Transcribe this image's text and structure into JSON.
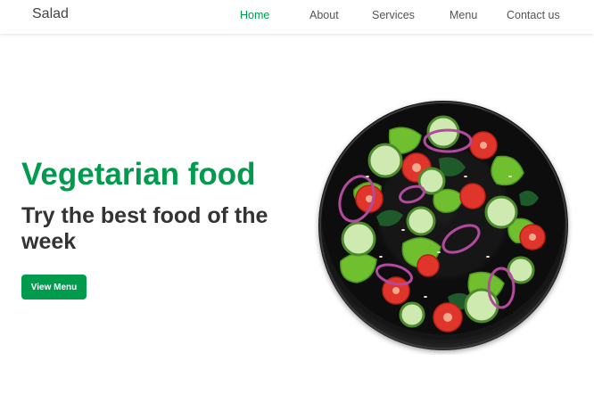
{
  "navbar": {
    "brand": "Salad",
    "links": [
      {
        "label": "Home",
        "active": true
      },
      {
        "label": "About",
        "active": false
      },
      {
        "label": "Services",
        "active": false
      },
      {
        "label": "Menu",
        "active": false
      },
      {
        "label": "Contact us",
        "active": false
      }
    ]
  },
  "hero": {
    "title": "Vegetarian food",
    "subtitle": "Try the best food of the week",
    "button_label": "View Menu"
  },
  "colors": {
    "accent": "#009b4d",
    "text_dark": "#333333",
    "nav_text": "#555555"
  },
  "image": {
    "icon": "salad-plate-image"
  }
}
